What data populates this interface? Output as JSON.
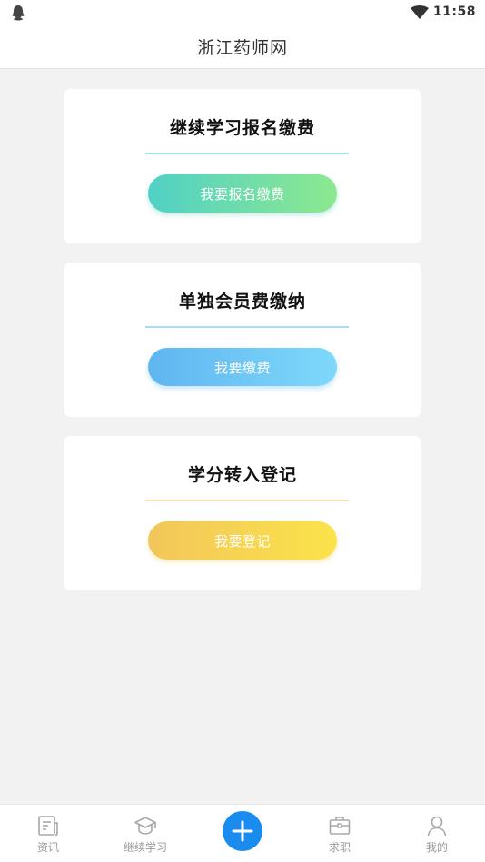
{
  "status_bar": {
    "time": "11:58"
  },
  "header": {
    "title": "浙江药师网"
  },
  "cards": [
    {
      "title": "继续学习报名缴费",
      "button_label": "我要报名缴费"
    },
    {
      "title": "单独会员费缴纳",
      "button_label": "我要缴费"
    },
    {
      "title": "学分转入登记",
      "button_label": "我要登记"
    }
  ],
  "bottom_nav": {
    "items": [
      {
        "label": "资讯",
        "icon": "news-icon"
      },
      {
        "label": "继续学习",
        "icon": "graduation-cap-icon"
      },
      {
        "label": "",
        "icon": "plus-icon"
      },
      {
        "label": "求职",
        "icon": "briefcase-icon"
      },
      {
        "label": "我的",
        "icon": "user-icon"
      }
    ]
  },
  "colors": {
    "accent_blue": "#1a8cf0",
    "button_green": "#4fd1c6",
    "button_blue": "#5fb6f0",
    "button_yellow": "#f2c65a"
  }
}
